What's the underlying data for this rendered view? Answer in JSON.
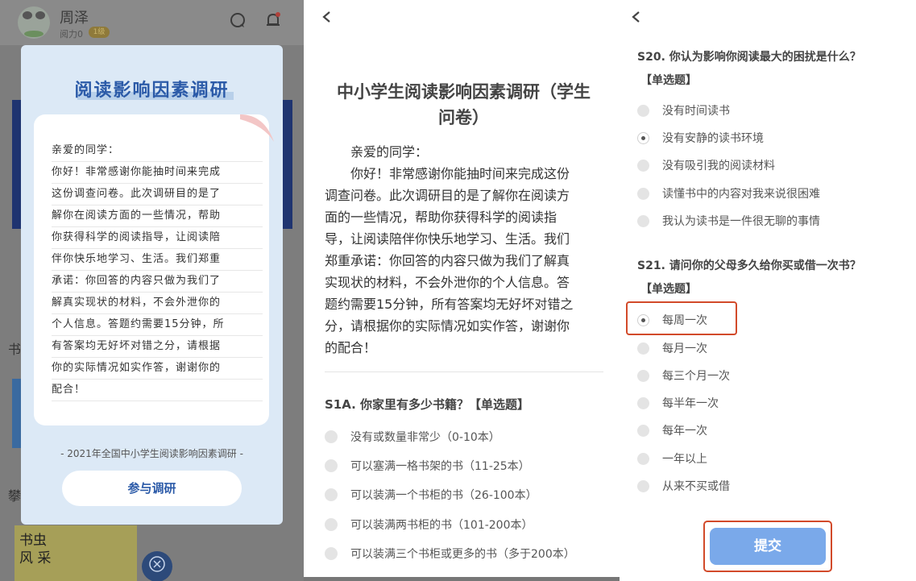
{
  "left_panel": {
    "user": {
      "name": "周泽",
      "subtitle": "阅力0",
      "badge": "1级"
    },
    "background": {
      "label1": "书",
      "label2": "攀"
    },
    "comic": {
      "text": "书虫\n风 采"
    },
    "modal": {
      "title": "阅读影响因素调研",
      "letter_lines": [
        "亲爱的同学：",
        "你好！非常感谢你能抽时间来完成",
        "这份调查问卷。此次调研目的是了",
        "解你在阅读方面的一些情况，帮助",
        "你获得科学的阅读指导，让阅读陪",
        "伴你快乐地学习、生活。我们郑重",
        "承诺：你回答的内容只做为我们了",
        "解真实现状的材料，不会外泄你的",
        "个人信息。答题约需要15分钟，所",
        "有答案均无好坏对错之分，请根据",
        "你的实际情况如实作答，谢谢你的",
        "配合！"
      ],
      "footer": "- 2021年全国中小学生阅读影响因素调研 -",
      "button": "参与调研"
    }
  },
  "middle_panel": {
    "title_line1": "中小学生阅读影响因素调研（学生",
    "title_line2": "问卷）",
    "intro_lines": [
      "　　亲爱的同学：",
      "　　你好！非常感谢你能抽时间来完成这份",
      "调查问卷。此次调研目的是了解你在阅读方",
      "面的一些情况，帮助你获得科学的阅读指",
      "导，让阅读陪伴你快乐地学习、生活。我们",
      "郑重承诺：你回答的内容只做为我们了解真",
      "实现状的材料，不会外泄你的个人信息。答",
      "题约需要15分钟，所有答案均无好坏对错之",
      "分，请根据你的实际情况如实作答，谢谢你",
      "的配合！"
    ],
    "question": "S1A. 你家里有多少书籍？【单选题】",
    "options": [
      "没有或数量非常少（0-10本）",
      "可以塞满一格书架的书（11-25本）",
      "可以装满一个书柜的书（26-100本）",
      "可以装满两书柜的书（101-200本）",
      "可以装满三个书柜或更多的书（多于200本）"
    ]
  },
  "right_panel": {
    "q20": {
      "question": "S20. 你认为影响你阅读最大的困扰是什么？",
      "type": "【单选题】",
      "options": [
        "没有时间读书",
        "没有安静的读书环境",
        "没有吸引我的阅读材料",
        "读懂书中的内容对我来说很困难",
        "我认为读书是一件很无聊的事情"
      ],
      "selected": "没有安静的读书环境"
    },
    "q21": {
      "question": "S21. 请问你的父母多久给你买或借一次书？",
      "type": "【单选题】",
      "options": [
        "每周一次",
        "每月一次",
        "每三个月一次",
        "每半年一次",
        "每年一次",
        "一年以上",
        "从来不买或借"
      ],
      "selected": "每周一次"
    },
    "submit": "提交",
    "highlight_color": "#d24a2a",
    "submit_color": "#7aa9ea"
  }
}
